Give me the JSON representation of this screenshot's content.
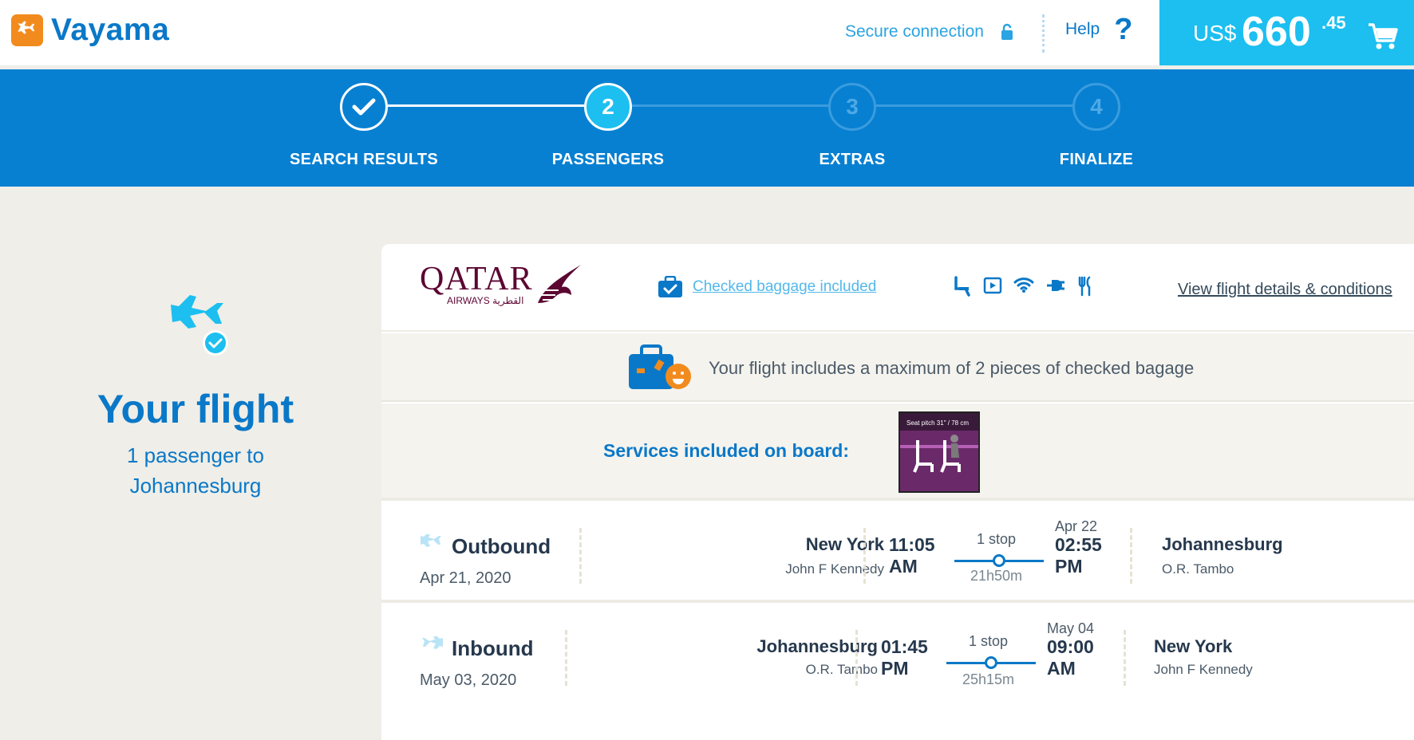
{
  "header": {
    "brand": "Vayama",
    "secure_label": "Secure connection",
    "help_label": "Help",
    "help_glyph": "?",
    "price_currency": "US$",
    "price_integer": "660",
    "price_decimal": ".45"
  },
  "steps": [
    {
      "number": "",
      "label": "SEARCH RESULTS",
      "state": "done"
    },
    {
      "number": "2",
      "label": "PASSENGERS",
      "state": "active"
    },
    {
      "number": "3",
      "label": "EXTRAS",
      "state": "pending"
    },
    {
      "number": "4",
      "label": "FINALIZE",
      "state": "pending"
    }
  ],
  "sidebar": {
    "title": "Your flight",
    "subtitle_line1": "1 passenger to",
    "subtitle_line2": "Johannesburg"
  },
  "flight": {
    "airline_logo_text": "QATAR",
    "airline_logo_sub": "AIRWAYS القطرية",
    "baggage_link": "Checked baggage included",
    "details_link": "View flight details & conditions",
    "baggage_info": "Your flight includes a maximum of 2 pieces of checked bagage",
    "services_label": "Services included on board:",
    "seat_pitch_caption": "Seat pitch 31\" / 78 cm",
    "amenities": [
      "seat-icon",
      "video-icon",
      "wifi-icon",
      "power-plug-icon",
      "meal-icon"
    ]
  },
  "legs": {
    "outbound": {
      "title": "Outbound",
      "date": "Apr 21, 2020",
      "from_city": "New York",
      "from_airport": "John F Kennedy",
      "dep_time": "11:05",
      "dep_ampm": "AM",
      "stops": "1 stop",
      "duration": "21h50m",
      "arr_date": "Apr 22",
      "arr_time": "02:55",
      "arr_ampm": "PM",
      "to_city": "Johannesburg",
      "to_airport": "O.R. Tambo"
    },
    "inbound": {
      "title": "Inbound",
      "date": "May 03, 2020",
      "from_city": "Johannesburg",
      "from_airport": "O.R. Tambo",
      "dep_time": "01:45",
      "dep_ampm": "PM",
      "stops": "1 stop",
      "duration": "25h15m",
      "arr_date": "May 04",
      "arr_time": "09:00",
      "arr_ampm": "AM",
      "to_city": "New York",
      "to_airport": "John F Kennedy"
    }
  },
  "colors": {
    "brand_blue": "#0780d2",
    "accent_cyan": "#1cbff0",
    "logo_orange": "#f28b1e"
  }
}
